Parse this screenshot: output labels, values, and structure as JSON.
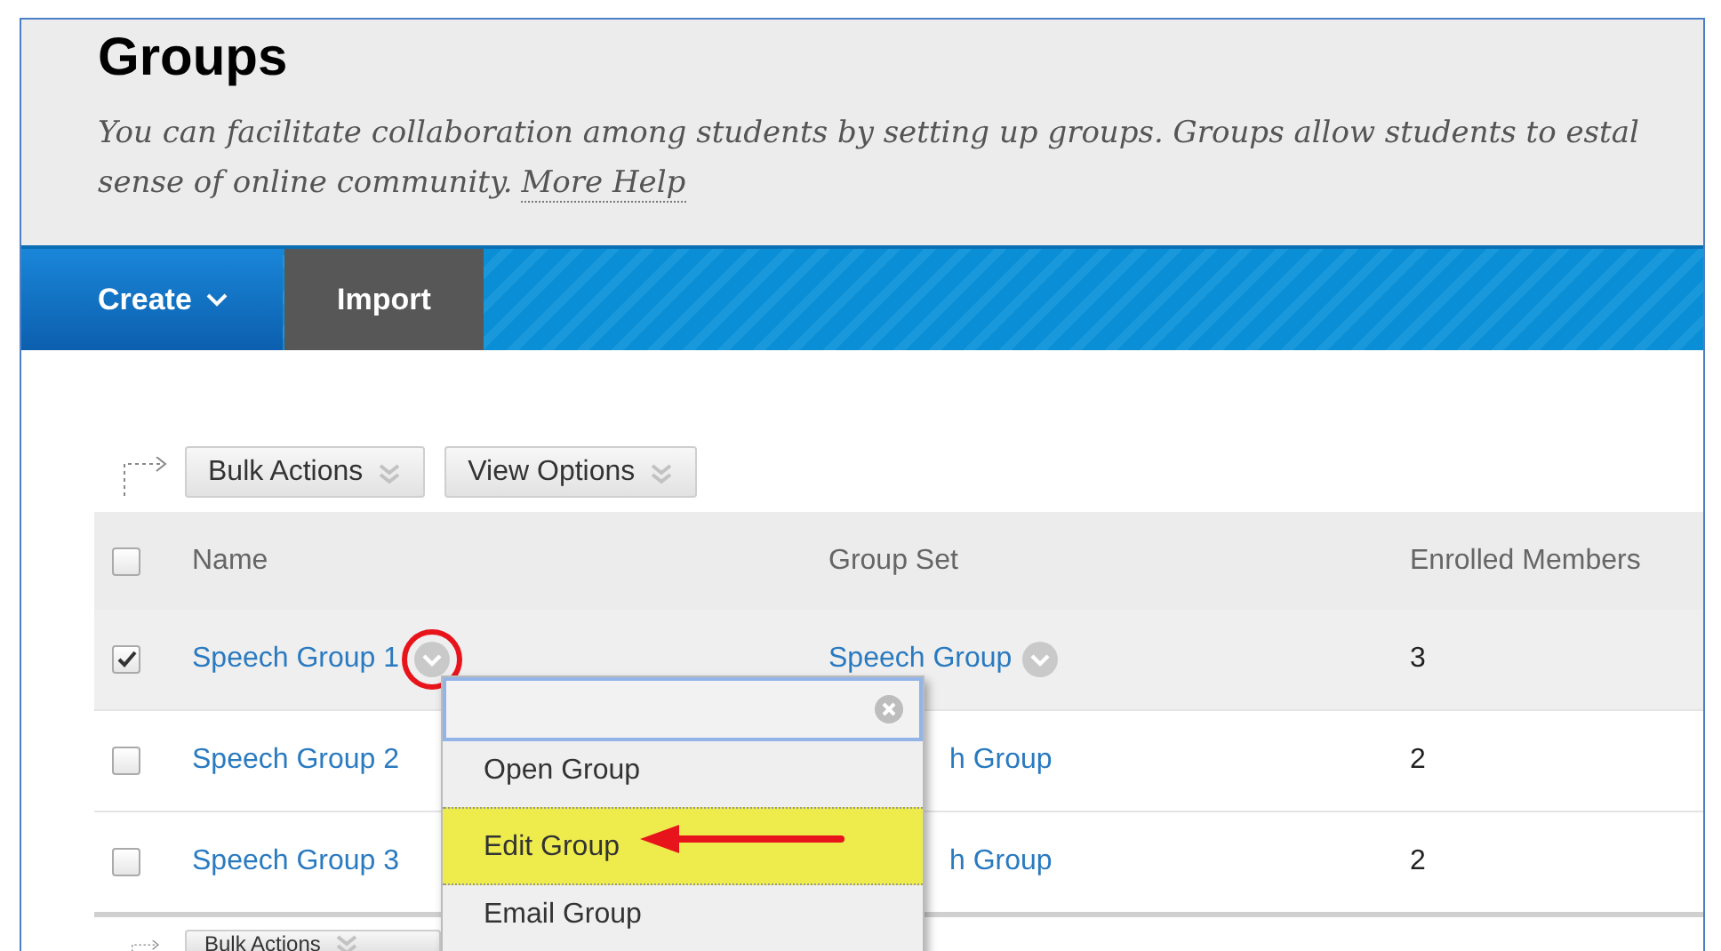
{
  "header": {
    "title": "Groups",
    "description_lines": [
      "You can facilitate collaboration among students by setting up groups. Groups allow students to estal",
      "sense of online community."
    ],
    "help_link": "More Help"
  },
  "nav": [
    {
      "label": "Create",
      "kind": "menu"
    },
    {
      "label": "Import",
      "kind": "plain"
    }
  ],
  "toolbar": {
    "buttons": [
      "Bulk Actions",
      "View Options"
    ]
  },
  "table": {
    "header_checked": false,
    "columns": [
      "Name",
      "Group Set",
      "Enrolled Members"
    ],
    "rows": [
      {
        "checked": true,
        "name": "Speech Group 1",
        "name_menu": true,
        "group_set": "Speech Group",
        "group_set_menu": true,
        "covered": false,
        "members": "3"
      },
      {
        "checked": false,
        "name": "Speech Group 2",
        "name_menu": false,
        "group_set": "h Group",
        "group_set_menu": false,
        "covered": true,
        "members": "2"
      },
      {
        "checked": false,
        "name": "Speech Group 3",
        "name_menu": false,
        "group_set": "h Group",
        "group_set_menu": false,
        "covered": true,
        "members": "2"
      }
    ]
  },
  "bottom_toolbar": {
    "buttons": [
      "Bulk Actions"
    ]
  },
  "context_menu": {
    "items": [
      {
        "label": "Open Group",
        "selected": false
      },
      {
        "label": "Edit Group",
        "selected": true
      },
      {
        "label": "Email Group",
        "selected": false
      }
    ]
  }
}
